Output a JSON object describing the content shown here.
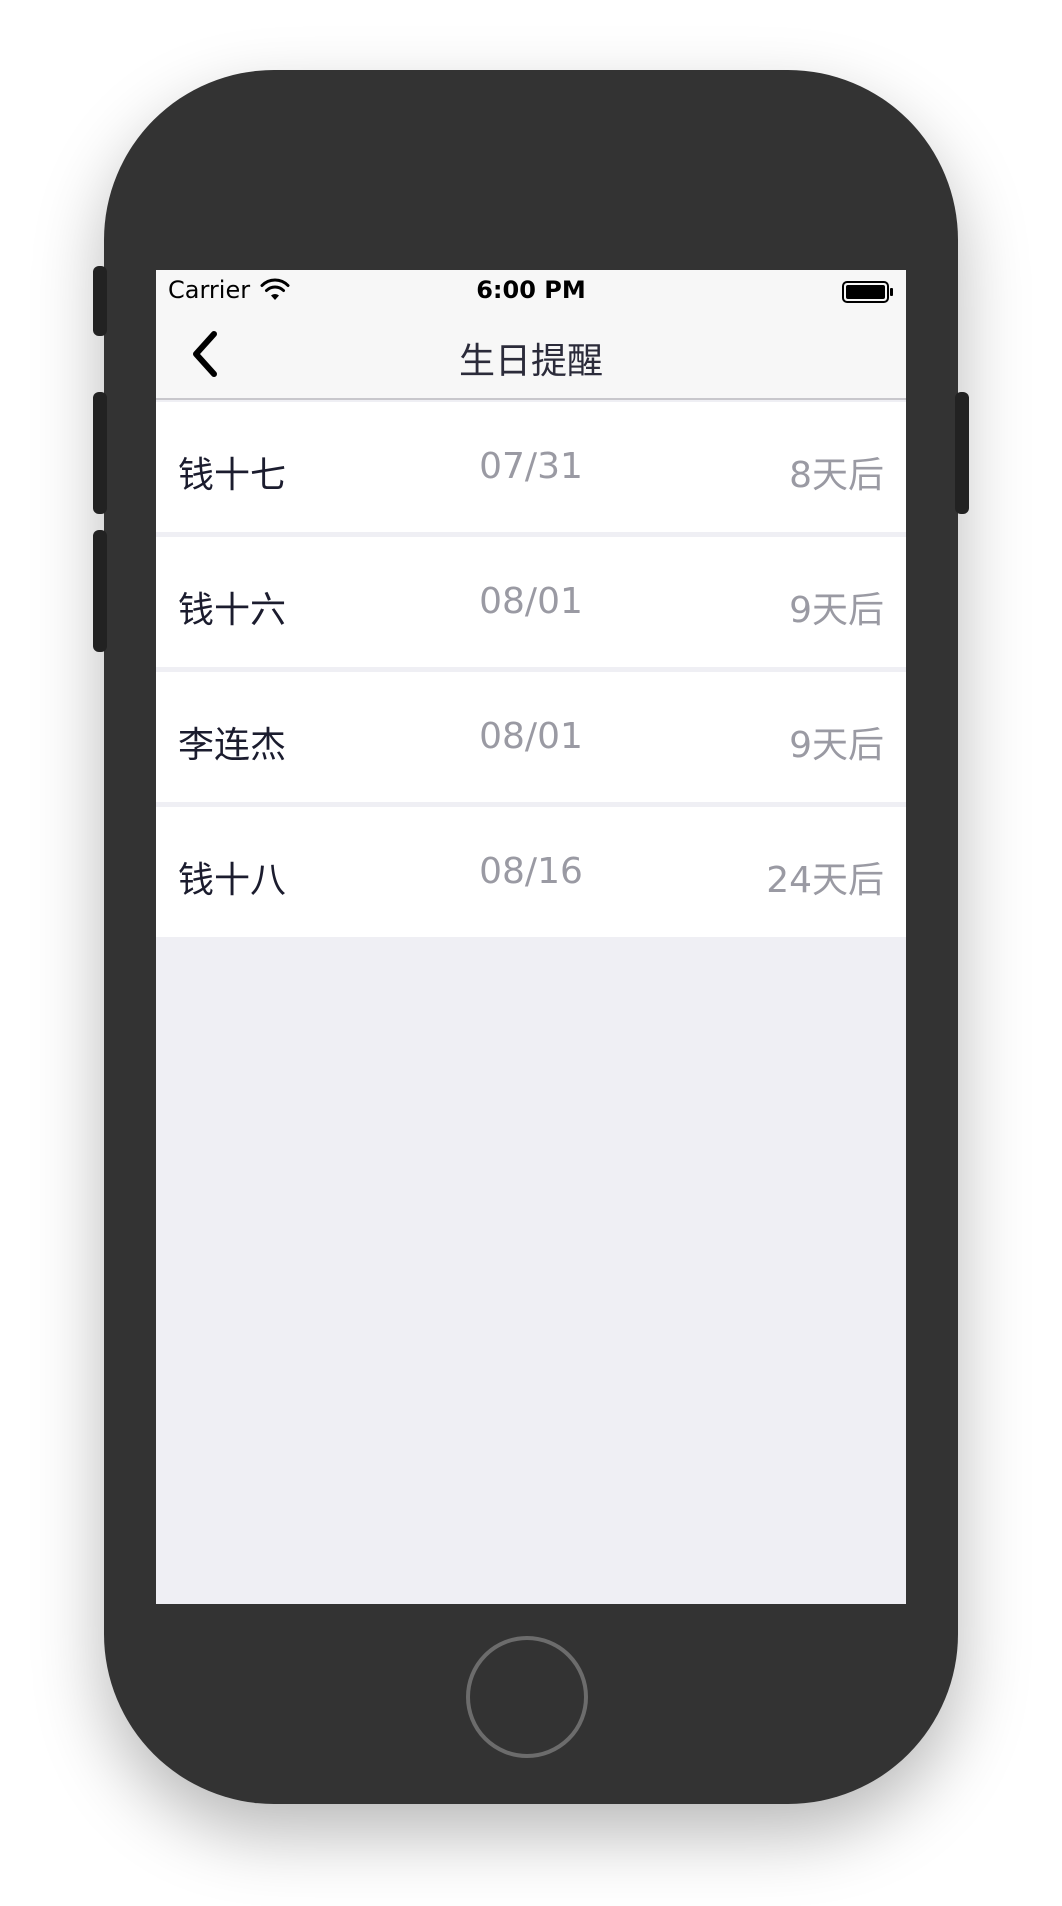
{
  "status_bar": {
    "carrier": "Carrier",
    "time": "6:00 PM"
  },
  "nav": {
    "title": "生日提醒",
    "back_icon": "chevron-left-icon"
  },
  "birthdays": [
    {
      "name": "钱十七",
      "date": "07/31",
      "days": "8天后"
    },
    {
      "name": "钱十六",
      "date": "08/01",
      "days": "9天后"
    },
    {
      "name": "李连杰",
      "date": "08/01",
      "days": "9天后"
    },
    {
      "name": "钱十八",
      "date": "08/16",
      "days": "24天后"
    }
  ],
  "colors": {
    "name_text": "#1b1c2e",
    "secondary_text": "#9a9aa3",
    "background": "#efeff4"
  }
}
